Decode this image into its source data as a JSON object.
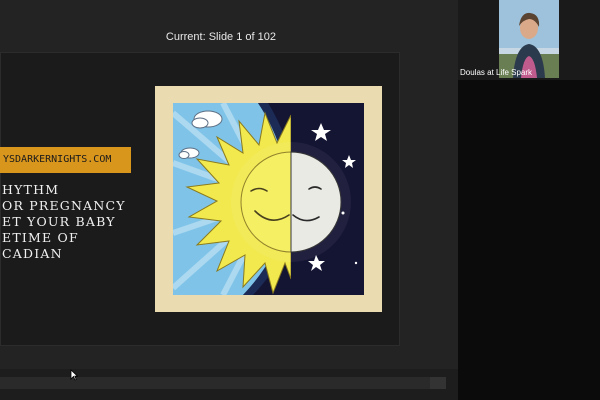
{
  "slide_counter": "Current: Slide 1 of 102",
  "slide": {
    "url_tag": "YSDARKERNIGHTS.COM",
    "text_lines": [
      "HYTHM",
      "OR PREGNANCY",
      "ET YOUR BABY",
      "ETIME OF",
      "CADIAN"
    ]
  },
  "artwork": {
    "icons": [
      "sun-icon",
      "moon-icon",
      "star-icon",
      "cloud-icon"
    ]
  },
  "participant": {
    "name": "Doulas at Life Spark"
  },
  "colors": {
    "background": "#1f1f1f",
    "url_tag": "#d9961c",
    "artwork_frame": "#eadcb0",
    "sky_day": "#7fc4e8",
    "sky_night": "#141433",
    "sun": "#f2e94e"
  }
}
